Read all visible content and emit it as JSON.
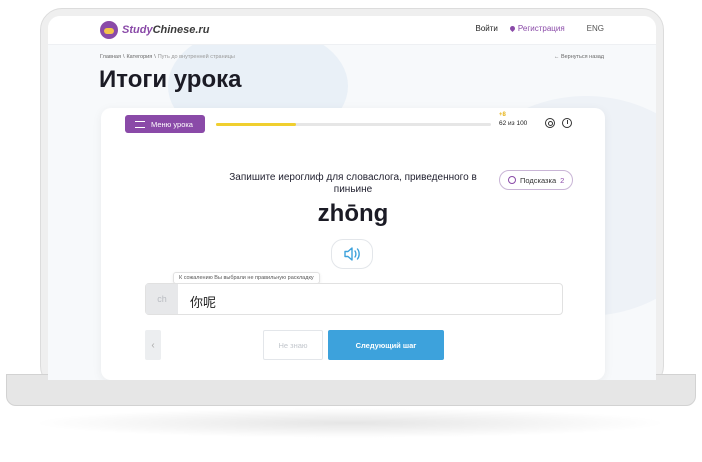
{
  "header": {
    "logo": {
      "part1": "Study",
      "part2": "Chinese.ru"
    },
    "login": "Войти",
    "register": "Регистрация",
    "language": "ENG"
  },
  "breadcrumbs": [
    "Главная",
    "\\",
    "Категория",
    "\\",
    "Путь до внутренней страницы"
  ],
  "back_link": "← Вернуться назад",
  "page_title": "Итоги урока",
  "lesson": {
    "menu_button": "Меню урока",
    "progress_fraction": 0.29,
    "points_gained": "+8",
    "score": "62 из 100"
  },
  "exercise": {
    "question": "Запишите иероглиф для словаслога, приведенного в пиньине",
    "pinyin": "zhōng",
    "hint_label": "Подсказка",
    "hint_count": "2",
    "warning": "К сожалению Вы выбрали не правильную раскладку",
    "input_lang": "ch",
    "answer_value": "你呢",
    "dont_know": "Не знаю",
    "next_step": "Следующий шаг",
    "prev": "‹"
  },
  "colors": {
    "brand_purple": "#8a4aa8",
    "progress_yellow": "#f0cf2f",
    "primary_blue": "#3da2dc"
  },
  "icons": [
    "logo-icon",
    "location-pin-icon",
    "hamburger-icon",
    "gear-icon",
    "speedometer-icon",
    "hint-icon",
    "speaker-icon",
    "chevron-left-icon"
  ]
}
